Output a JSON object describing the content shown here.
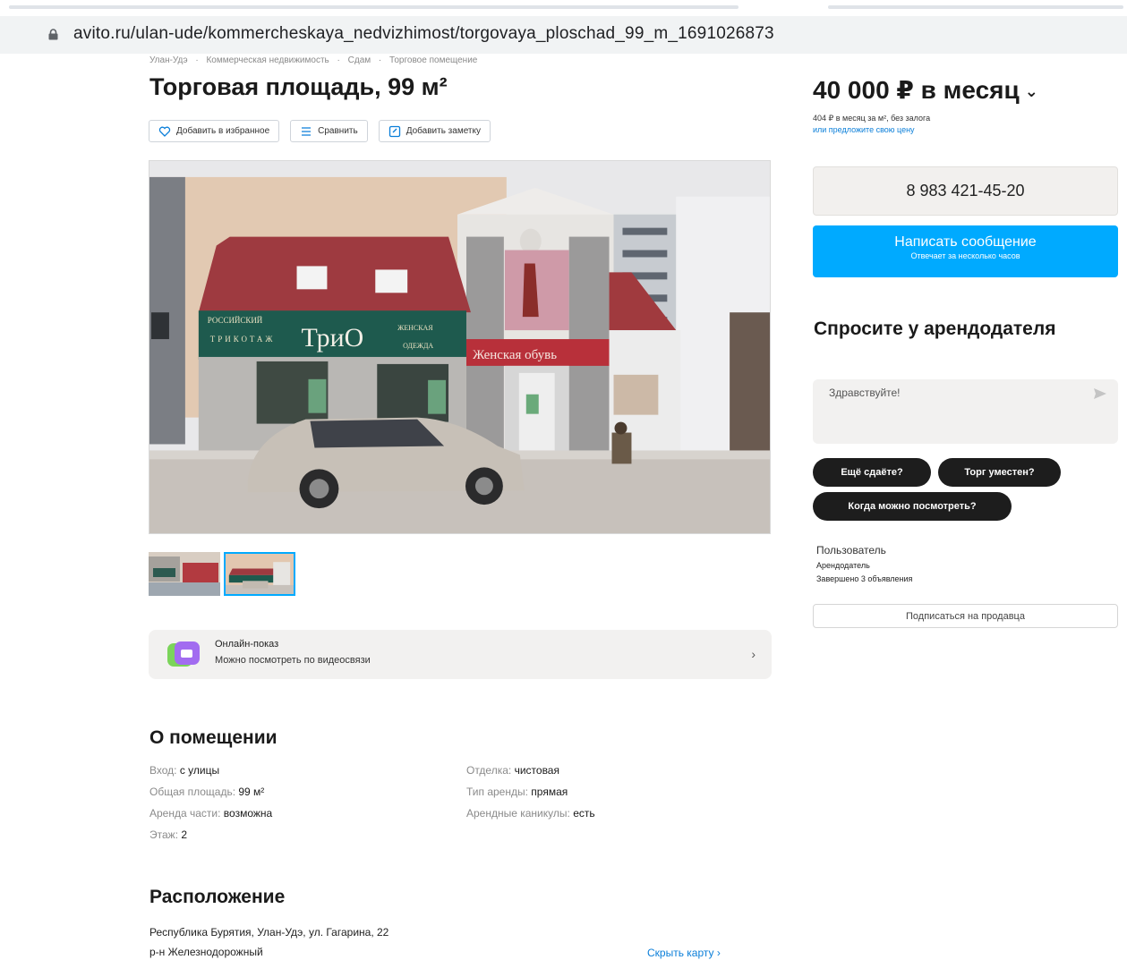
{
  "browser": {
    "url": "avito.ru/ulan-ude/kommercheskaya_nedvizhimost/torgovaya_ploschad_99_m_1691026873"
  },
  "breadcrumb": [
    "Улан-Удэ",
    "·",
    "Коммерческая недвижимость",
    "·",
    "Сдам",
    "·",
    "Торговое помещение"
  ],
  "listing": {
    "title": "Торговая площадь, 99 м²",
    "actions": {
      "favorite": "Добавить в избранное",
      "compare": "Сравнить",
      "note": "Добавить заметку"
    }
  },
  "photo": {
    "signs": {
      "left_top": "РОССИЙСКИЙ",
      "left_bottom": "ТРИКОТАЖ",
      "brand": "ТриО",
      "right_top": "ЖЕНСКАЯ",
      "right_bottom": "ОДЕЖДА",
      "shoes": "Женская обувь"
    }
  },
  "online_show": {
    "title": "Онлайн-показ",
    "subtitle": "Можно посмотреть по видеосвязи",
    "chevron": "›"
  },
  "about": {
    "title": "О помещении",
    "left": [
      {
        "key": "Вход:",
        "value": "с улицы"
      },
      {
        "key": "Общая площадь:",
        "value": "99 м²"
      },
      {
        "key": "Аренда части:",
        "value": "возможна"
      },
      {
        "key": "Этаж:",
        "value": "2"
      }
    ],
    "right": [
      {
        "key": "Отделка:",
        "value": "чистовая"
      },
      {
        "key": "Тип аренды:",
        "value": "прямая"
      },
      {
        "key": "Арендные каникулы:",
        "value": "есть"
      }
    ]
  },
  "location": {
    "title": "Расположение",
    "address": "Республика Бурятия, Улан-Удэ, ул. Гагарина, 22",
    "district": "р-н Железнодорожный",
    "hide_map": "Скрыть карту ›"
  },
  "price": {
    "value": "40 000 ₽ в месяц",
    "arrow": "⌄",
    "per_meter": "404 ₽ в месяц за м², без залога",
    "offer_link": "или предложите свою цену"
  },
  "contact": {
    "phone": "8 983 421-45-20",
    "message_button": "Написать сообщение",
    "message_sub": "Отвечает за несколько часов"
  },
  "ask": {
    "title": "Спросите у арендодателя",
    "input_value": "Здравствуйте!",
    "chips": [
      "Ещё сдаёте?",
      "Торг уместен?",
      "Когда можно посмотреть?"
    ]
  },
  "seller": {
    "name": "Пользователь",
    "role": "Арендодатель",
    "completed": "Завершено 3 объявления",
    "subscribe": "Подписаться на продавца"
  },
  "colors": {
    "accent_blue": "#00aaff",
    "link_blue": "#0a7ed9",
    "chip_dark": "#1d1d1d"
  }
}
